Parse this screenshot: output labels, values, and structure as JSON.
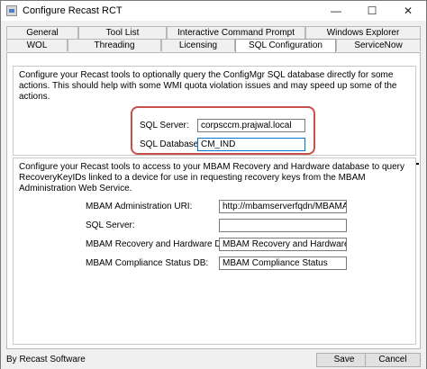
{
  "window": {
    "title": "Configure Recast RCT",
    "controls": {
      "minimize": "—",
      "maximize": "☐",
      "close": "✕"
    }
  },
  "tabs": {
    "row1": [
      "General",
      "Tool List",
      "Interactive Command Prompt",
      "Windows Explorer"
    ],
    "row2": [
      "WOL",
      "Threading",
      "Licensing",
      "SQL Configuration",
      "ServiceNow"
    ],
    "selected": "SQL Configuration"
  },
  "configmgr": {
    "description": "Configure your Recast tools to optionally query the ConfigMgr SQL database directly for some actions. This should help with some WMI quota violation issues and may speed up some of the actions.",
    "sql_server_label": "SQL Server:",
    "sql_server_value": "corpsccm.prajwal.local",
    "sql_database_label": "SQL Database:",
    "sql_database_value": "CM_IND"
  },
  "mbam": {
    "description": "Configure your Recast tools to access to your MBAM Recovery and Hardware database to query RecoveryKeyIDs linked to a device for use in requesting recovery keys from the MBAM Administration Web Service.",
    "admin_uri_label": "MBAM Administration URI:",
    "admin_uri_value": "http://mbamserverfqdn/MBAMAdn",
    "sql_server_label": "SQL Server:",
    "sql_server_value": "",
    "recovery_db_label": "MBAM Recovery and Hardware DB:",
    "recovery_db_value": "MBAM Recovery and Hardware",
    "compliance_db_label": "MBAM Compliance Status DB:",
    "compliance_db_value": "MBAM Compliance Status"
  },
  "footer": {
    "credit": "By Recast Software",
    "save_label": "Save",
    "cancel_label": "Cancel"
  },
  "colors": {
    "highlight_box": "#c9504a",
    "focus_border": "#0078d7"
  }
}
